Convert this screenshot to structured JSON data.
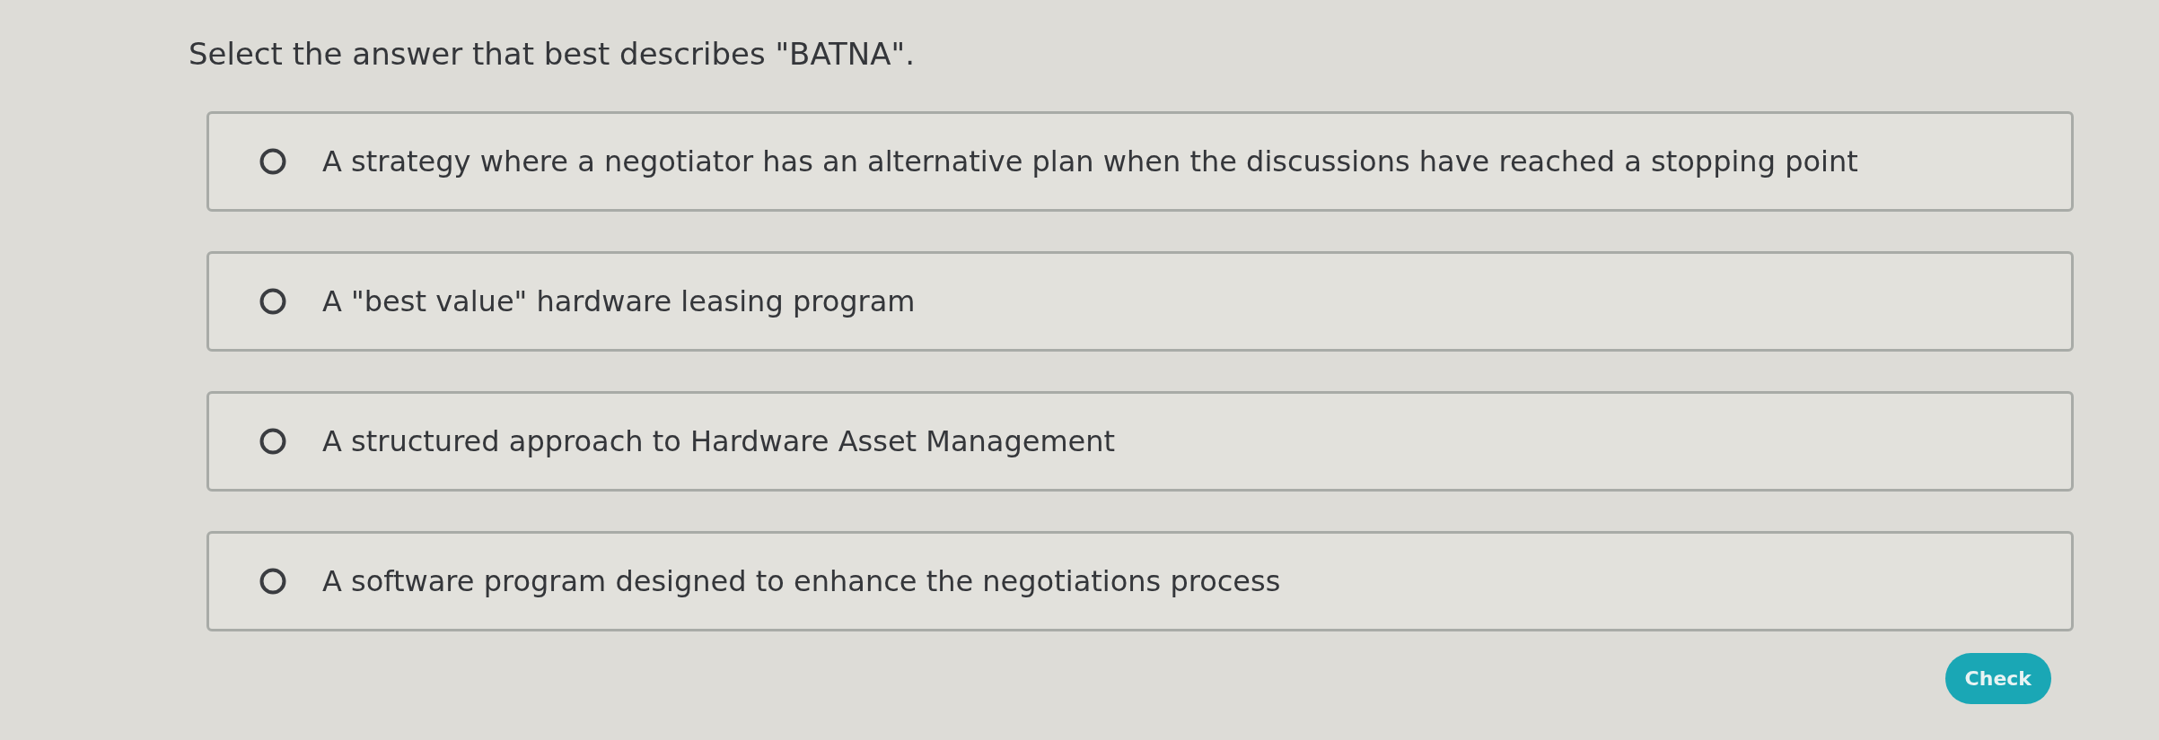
{
  "question": {
    "text": "Select the answer that best describes \"BATNA\"."
  },
  "options": [
    {
      "label": "A strategy where a negotiator has an alternative plan when the discussions have reached a stopping point",
      "selected": false
    },
    {
      "label": "A \"best value\" hardware leasing program",
      "selected": false
    },
    {
      "label": "A structured approach to Hardware Asset Management",
      "selected": false
    },
    {
      "label": "A software program designed to enhance the negotiations process",
      "selected": false
    }
  ],
  "check_button": {
    "label": "Check"
  }
}
